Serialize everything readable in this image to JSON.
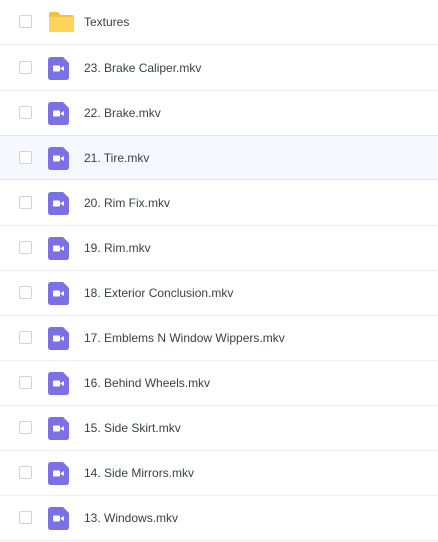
{
  "files": [
    {
      "name": "Textures",
      "type": "folder",
      "icon": "folder-icon"
    },
    {
      "name": "23. Brake Caliper.mkv",
      "type": "video",
      "icon": "video-file-icon"
    },
    {
      "name": "22. Brake.mkv",
      "type": "video",
      "icon": "video-file-icon"
    },
    {
      "name": "21. Tire.mkv",
      "type": "video",
      "icon": "video-file-icon"
    },
    {
      "name": "20. Rim Fix.mkv",
      "type": "video",
      "icon": "video-file-icon"
    },
    {
      "name": "19. Rim.mkv",
      "type": "video",
      "icon": "video-file-icon"
    },
    {
      "name": "18. Exterior Conclusion.mkv",
      "type": "video",
      "icon": "video-file-icon"
    },
    {
      "name": "17. Emblems N Window Wippers.mkv",
      "type": "video",
      "icon": "video-file-icon"
    },
    {
      "name": "16. Behind Wheels.mkv",
      "type": "video",
      "icon": "video-file-icon"
    },
    {
      "name": "15. Side Skirt.mkv",
      "type": "video",
      "icon": "video-file-icon"
    },
    {
      "name": "14. Side Mirrors.mkv",
      "type": "video",
      "icon": "video-file-icon"
    },
    {
      "name": "13. Windows.mkv",
      "type": "video",
      "icon": "video-file-icon"
    }
  ],
  "colors": {
    "folder": "#ffcd45",
    "video": "#7c70e6",
    "hover_row": "#f5f9ff"
  }
}
